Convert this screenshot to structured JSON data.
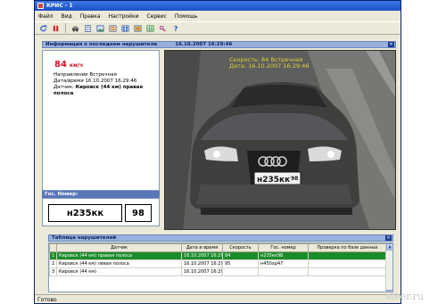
{
  "app": {
    "title": "КРИС - 1"
  },
  "menu": [
    "Файл",
    "Вид",
    "Правка",
    "Настройки",
    "Сервис",
    "Помощь"
  ],
  "toolbar": {
    "icons": [
      "refresh-icon",
      "pause-icon",
      "vehicle-icon",
      "document-icon",
      "image-icon",
      "image-zoom-icon",
      "image-list-icon",
      "print-preview-icon",
      "table-icon",
      "key-icon",
      "help-icon"
    ]
  },
  "info_panel": {
    "title": "Информация о последнем нарушителе",
    "datetime": "16.10.2007 16:29:46",
    "speed_value": "84",
    "speed_unit": "км/ч",
    "direction_label": "Направление",
    "direction_value": "Встречная",
    "datetime_label": "Дата/время",
    "datetime_value": "16.10.2007 16:29:46",
    "sensor_label": "Датчик:",
    "sensor_value": "Кировск (44 км) правая полоса"
  },
  "plate_panel": {
    "title": "Гос. Номер:",
    "number": "н235кк",
    "region": "98"
  },
  "photo": {
    "overlay_speed": "Скорость: 84 Встречная",
    "overlay_date": "Дата: 16.10.2007 16:29:46",
    "plate_text": "н235кк",
    "plate_region": "98"
  },
  "violations_table": {
    "title": "Таблица нарушителей",
    "columns": [
      "",
      "Датчик",
      "Дата и время",
      "Скорость",
      "Гос. номер",
      "Проверка по базе данных"
    ],
    "rows": [
      {
        "n": "1",
        "sensor": "Кировск (44 км) правая полоса",
        "datetime": "16.10.2007 16:29...",
        "speed": "84",
        "plate": "н235кк98",
        "check": ""
      },
      {
        "n": "2",
        "sensor": "Кировск (44 км) левая полоса",
        "datetime": "16.10.2007 16:29...",
        "speed": "95",
        "plate": "н450хр47",
        "check": ""
      },
      {
        "n": "3",
        "sensor": "Кировск (44 км)",
        "datetime": "16.10.2007 16:29...",
        "speed": "",
        "plate": "",
        "check": ""
      }
    ]
  },
  "status": {
    "text": "Готово"
  },
  "watermark": "steer.ru",
  "colors": {
    "accent": "#1d4fc4",
    "selected_row": "#1a8c2a",
    "speed": "#d7102a",
    "overlay": "#e0d23a"
  }
}
